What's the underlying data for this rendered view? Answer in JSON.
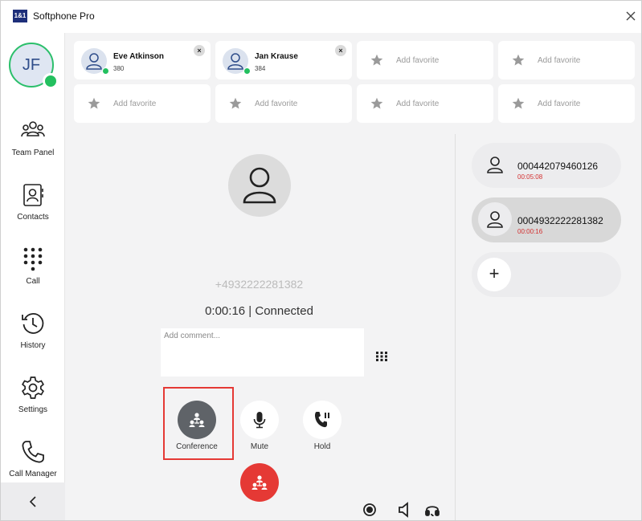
{
  "app": {
    "logo": "1&1",
    "title": "Softphone Pro"
  },
  "user": {
    "initials": "JF",
    "status_color": "#23c05f"
  },
  "sidebar": {
    "items": [
      {
        "label": "Team Panel",
        "icon": "team-panel-icon"
      },
      {
        "label": "Contacts",
        "icon": "contacts-icon"
      },
      {
        "label": "Call",
        "icon": "dialpad-icon"
      },
      {
        "label": "History",
        "icon": "history-icon"
      },
      {
        "label": "Settings",
        "icon": "settings-icon"
      },
      {
        "label": "Call Manager",
        "icon": "phone-icon"
      }
    ]
  },
  "favorites": [
    {
      "name": "Eve Atkinson",
      "ext": "380"
    },
    {
      "name": "Jan Krause",
      "ext": "384"
    },
    {
      "add": "Add favorite"
    },
    {
      "add": "Add favorite"
    },
    {
      "add": "Add favorite"
    },
    {
      "add": "Add favorite"
    },
    {
      "add": "Add favorite"
    },
    {
      "add": "Add favorite"
    }
  ],
  "favorite_remove": "×",
  "call": {
    "number": "+4932222281382",
    "status": "0:00:16 | Connected",
    "comment_placeholder": "Add comment..."
  },
  "actions": {
    "conference": "Conference",
    "mute": "Mute",
    "hold": "Hold"
  },
  "calls": [
    {
      "number": "000442079460126",
      "duration": "00:05:08"
    },
    {
      "number": "0004932222281382",
      "duration": "00:00:16"
    }
  ],
  "add_call": "+",
  "colors": {
    "accent_red": "#e53935",
    "online_green": "#23c05f",
    "duration_red": "#d32f2f"
  }
}
